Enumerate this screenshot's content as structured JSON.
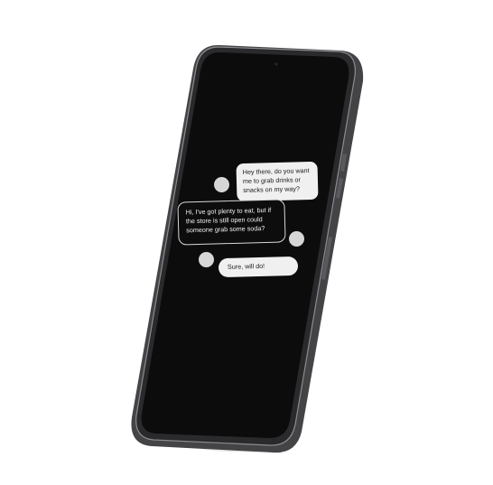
{
  "conversation": {
    "messages": [
      {
        "sender": "other",
        "text": "Hey there, do you want me to grab drinks or snacks on my way?"
      },
      {
        "sender": "me",
        "text": "Hi, I've got plenty to eat, but if the store is still open could someone grab some soda?"
      },
      {
        "sender": "other",
        "text": "Sure, will do!"
      }
    ]
  },
  "colors": {
    "screen": "#0c0c0d",
    "frame": "#2a2a2c",
    "bubble_light": "#f0f0f0",
    "bubble_dark": "#0d0d0e",
    "avatar": "#d6d6d6"
  }
}
